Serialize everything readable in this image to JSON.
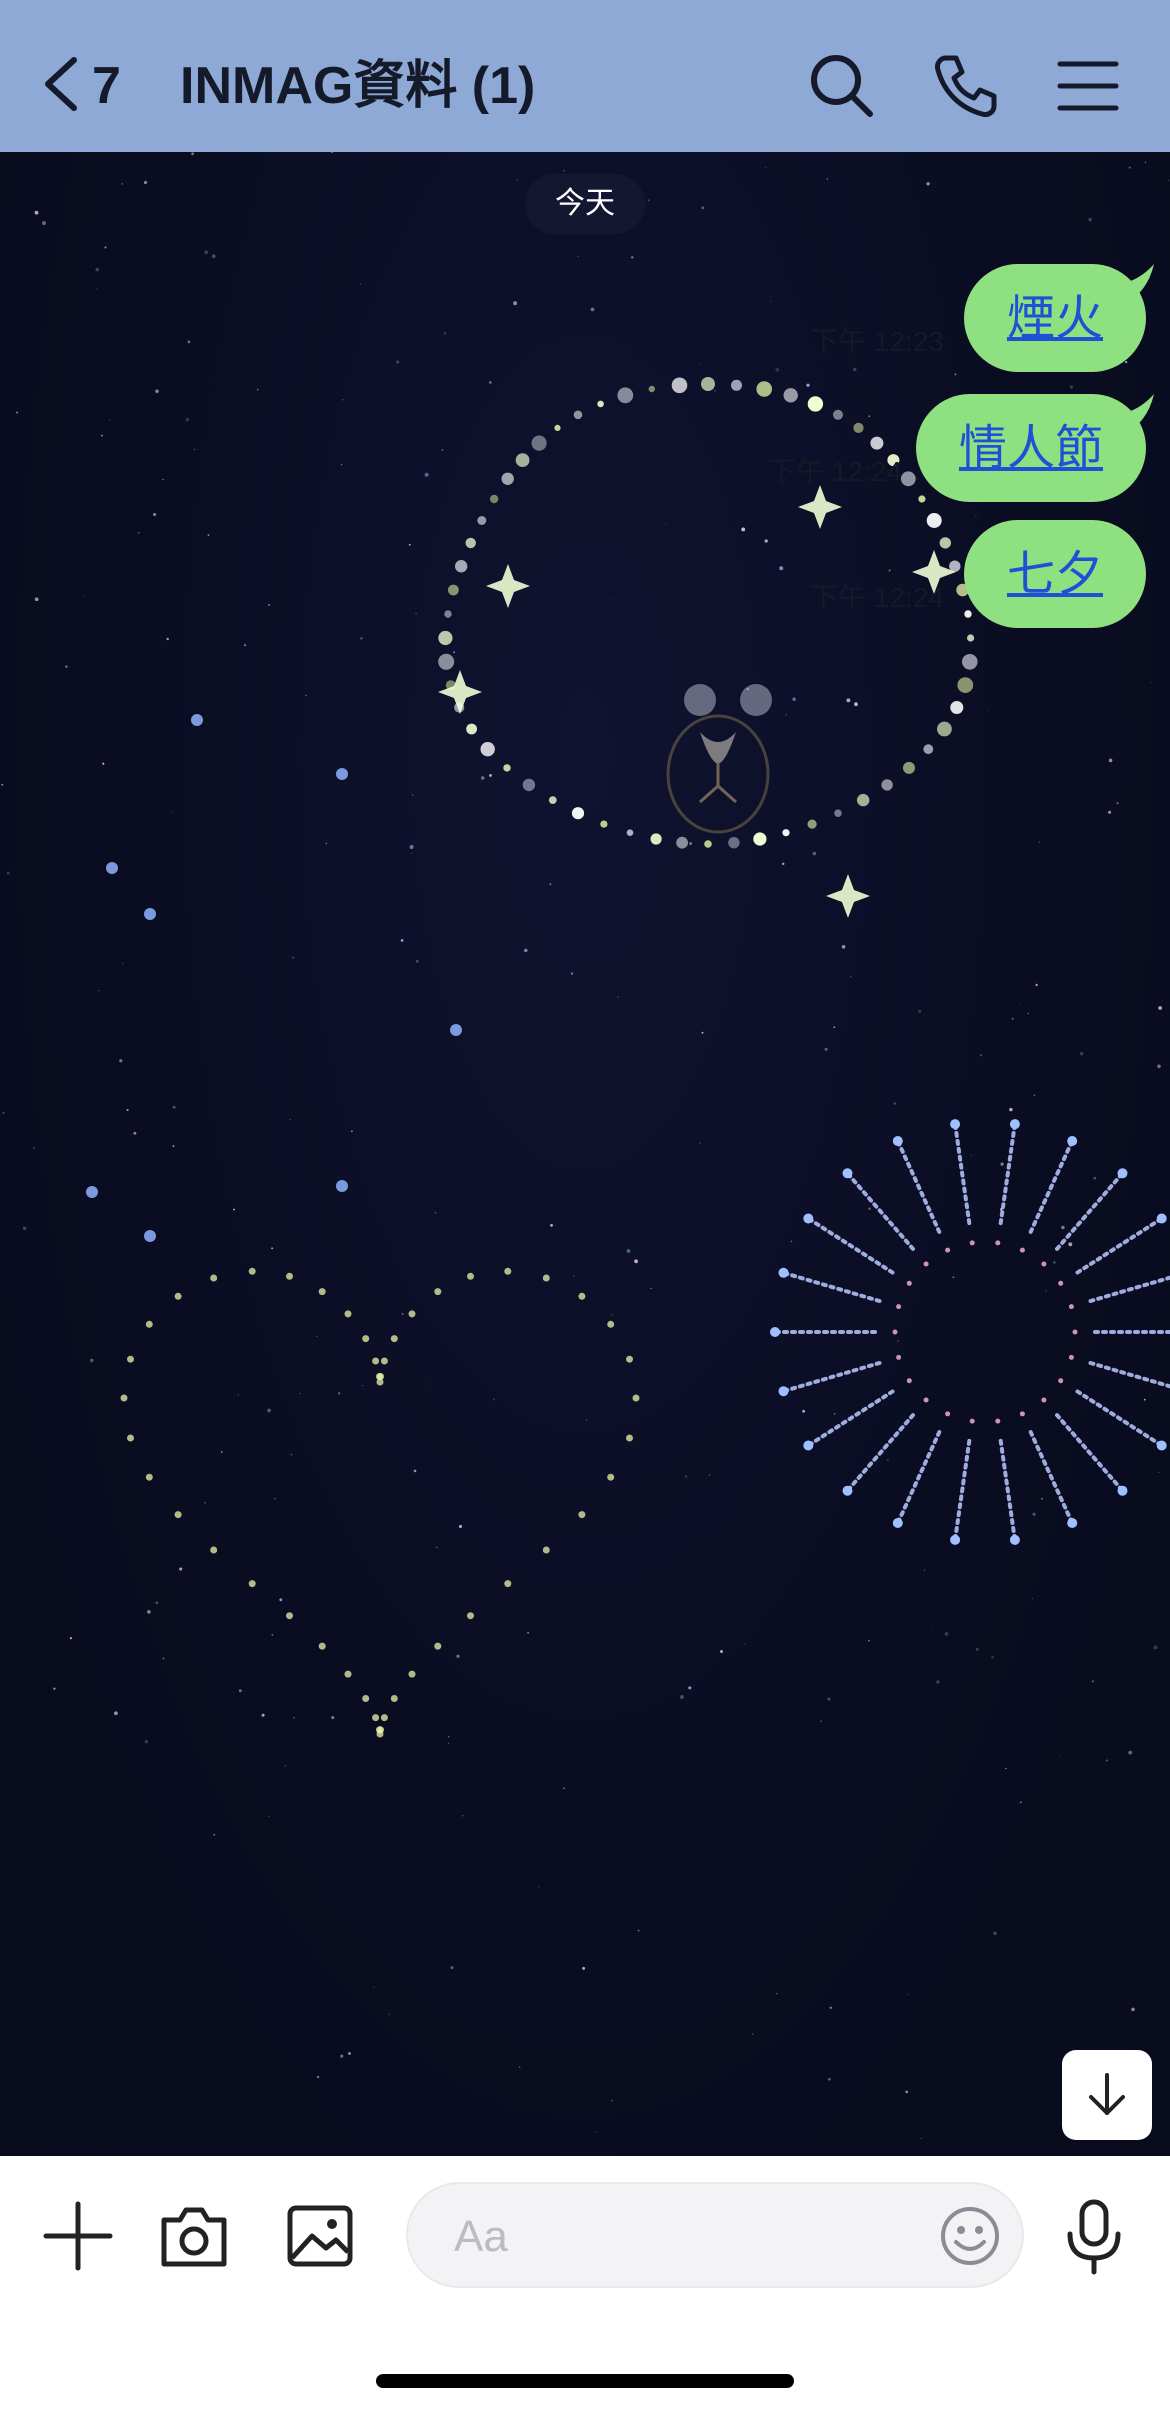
{
  "header": {
    "unread_count": "7",
    "title": "INMAG資料 (1)",
    "icons": [
      "chevron-left-icon",
      "search-icon",
      "phone-icon",
      "menu-icon"
    ],
    "background_color": "#8fa9d6"
  },
  "chat": {
    "date_label": "今天",
    "background_color": "#0a0d22",
    "messages": [
      {
        "text": "煙火",
        "time": "下午 12:23"
      },
      {
        "text": "情人節",
        "time": "下午 12:24"
      },
      {
        "text": "七夕",
        "time": "下午 12:24"
      }
    ],
    "bubble_color": "#8fe080",
    "link_color": "#1f51d6"
  },
  "input": {
    "placeholder": "Aa",
    "icons": [
      "plus-icon",
      "camera-icon",
      "image-icon",
      "emoji-icon",
      "microphone-icon",
      "arrow-down-icon"
    ]
  }
}
